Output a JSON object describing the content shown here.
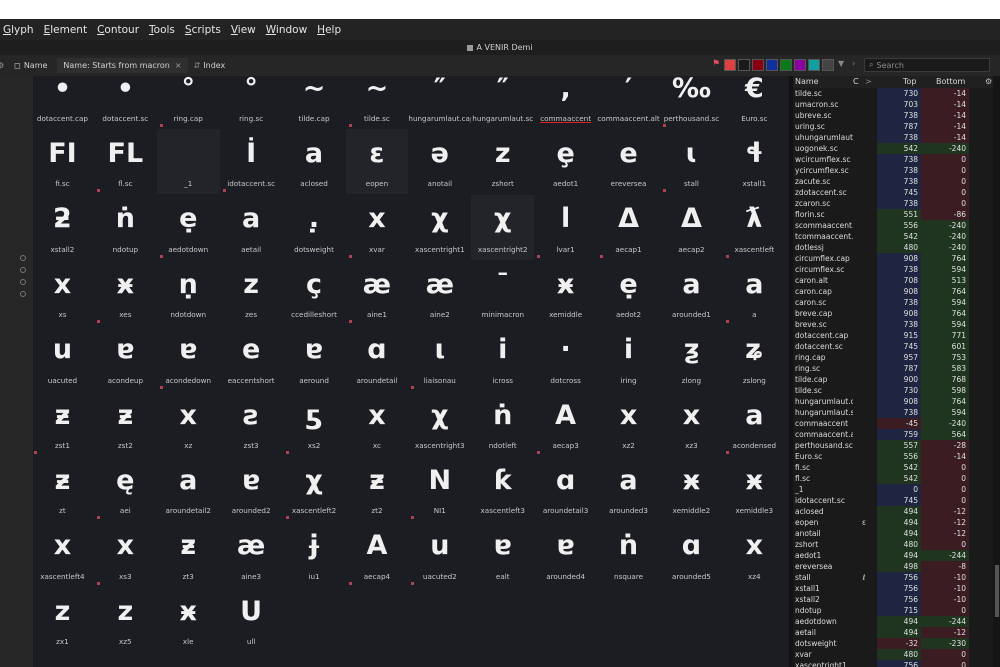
{
  "menu": [
    "Glyph",
    "Element",
    "Contour",
    "Tools",
    "Scripts",
    "View",
    "Window",
    "Help"
  ],
  "window_title": "A VENIR Demi",
  "toolbar": {
    "name_label": "Name",
    "filter_tab": "Name: Starts from macron",
    "index_label": "Index",
    "search_placeholder": "Search",
    "swatches": [
      "#e04040",
      "#1a1a1a",
      "#8a0010",
      "#1030a0",
      "#0a7a1a",
      "#8a00a0",
      "#10a0a0",
      "#444444"
    ]
  },
  "grid": {
    "selected_glyph": "commaaccent",
    "glyphs": [
      {
        "char": "•",
        "name": "dotaccent.cap",
        "shade": false
      },
      {
        "char": "•",
        "name": "dotaccent.sc",
        "shade": false
      },
      {
        "char": "°",
        "name": "ring.cap",
        "shade": false
      },
      {
        "char": "°",
        "name": "ring.sc",
        "shade": false
      },
      {
        "char": "~",
        "name": "tilde.cap",
        "shade": false
      },
      {
        "char": "~",
        "name": "tilde.sc",
        "shade": false
      },
      {
        "char": "″",
        "name": "hungarumlaut.cap",
        "shade": false
      },
      {
        "char": "″",
        "name": "hungarumlaut.sc",
        "shade": false
      },
      {
        "char": ",",
        "name": "commaaccent",
        "shade": false
      },
      {
        "char": "′",
        "name": "commaaccent.alt",
        "shade": false
      },
      {
        "char": "‰",
        "name": "perthousand.sc",
        "shade": false
      },
      {
        "char": "€",
        "name": "Euro.sc",
        "shade": false
      },
      {
        "char": "FI",
        "name": "fi.sc",
        "shade": false
      },
      {
        "char": "FL",
        "name": "fl.sc",
        "shade": false
      },
      {
        "char": "",
        "name": "_1",
        "shade": true
      },
      {
        "char": "İ",
        "name": "idotaccent.sc",
        "shade": false
      },
      {
        "char": "a",
        "name": "aclosed",
        "shade": false
      },
      {
        "char": "ɛ",
        "name": "eopen",
        "shade": true
      },
      {
        "char": "ə",
        "name": "anotail",
        "shade": false
      },
      {
        "char": "z",
        "name": "zshort",
        "shade": false
      },
      {
        "char": "ȩ",
        "name": "aedot1",
        "shade": false
      },
      {
        "char": "e",
        "name": "ereversea",
        "shade": false
      },
      {
        "char": "ɩ",
        "name": "stall",
        "shade": false
      },
      {
        "char": "ɬ",
        "name": "xstall1",
        "shade": false
      },
      {
        "char": "ƻ",
        "name": "xstall2",
        "shade": false
      },
      {
        "char": "ṅ",
        "name": "ndotup",
        "shade": false
      },
      {
        "char": "ẹ",
        "name": "aedotdown",
        "shade": false
      },
      {
        "char": "a",
        "name": "aetail",
        "shade": false
      },
      {
        "char": ".̣",
        "name": "dotsweight",
        "shade": false
      },
      {
        "char": "x",
        "name": "xvar",
        "shade": false
      },
      {
        "char": "χ",
        "name": "xascentright1",
        "shade": false
      },
      {
        "char": "χ",
        "name": "xascentright2",
        "shade": true
      },
      {
        "char": "l",
        "name": "lvar1",
        "shade": false
      },
      {
        "char": "Δ",
        "name": "aecap1",
        "shade": false
      },
      {
        "char": "Δ",
        "name": "aecap2",
        "shade": false
      },
      {
        "char": "ƛ",
        "name": "xascentleft",
        "shade": false
      },
      {
        "char": "x",
        "name": "xs",
        "shade": false
      },
      {
        "char": "ӿ",
        "name": "xes",
        "shade": false
      },
      {
        "char": "ṇ",
        "name": "ndotdown",
        "shade": false
      },
      {
        "char": "z",
        "name": "zes",
        "shade": false
      },
      {
        "char": "ç",
        "name": "ccedilleshort",
        "shade": false
      },
      {
        "char": "æ",
        "name": "aine1",
        "shade": false
      },
      {
        "char": "æ",
        "name": "aine2",
        "shade": false
      },
      {
        "char": "¯",
        "name": "minimacron",
        "shade": false
      },
      {
        "char": "ӿ",
        "name": "xemiddle",
        "shade": false
      },
      {
        "char": "ẹ",
        "name": "aedot2",
        "shade": false
      },
      {
        "char": "a",
        "name": "arounded1",
        "shade": false
      },
      {
        "char": "a",
        "name": "a",
        "shade": false
      },
      {
        "char": "u",
        "name": "uacuted",
        "shade": false
      },
      {
        "char": "ɐ",
        "name": "acondeup",
        "shade": false
      },
      {
        "char": "ɐ",
        "name": "acondedown",
        "shade": false
      },
      {
        "char": "e",
        "name": "eaccentshort",
        "shade": false
      },
      {
        "char": "ɐ",
        "name": "aeround",
        "shade": false
      },
      {
        "char": "ɑ",
        "name": "aroundetail",
        "shade": false
      },
      {
        "char": "ι",
        "name": "liaisonau",
        "shade": false
      },
      {
        "char": "i",
        "name": "icross",
        "shade": false
      },
      {
        "char": "·",
        "name": "dotcross",
        "shade": false
      },
      {
        "char": "i",
        "name": "iring",
        "shade": false
      },
      {
        "char": "ƺ",
        "name": "zlong",
        "shade": false
      },
      {
        "char": "ʑ",
        "name": "zslong",
        "shade": false
      },
      {
        "char": "ƶ",
        "name": "zst1",
        "shade": false
      },
      {
        "char": "ƶ",
        "name": "zst2",
        "shade": false
      },
      {
        "char": "ⅹ",
        "name": "xz",
        "shade": false
      },
      {
        "char": "ƨ",
        "name": "zst3",
        "shade": false
      },
      {
        "char": "ƽ",
        "name": "xs2",
        "shade": false
      },
      {
        "char": "x",
        "name": "xc",
        "shade": false
      },
      {
        "char": "χ",
        "name": "xascentright3",
        "shade": false
      },
      {
        "char": "ṅ",
        "name": "ndotleft",
        "shade": false
      },
      {
        "char": "A",
        "name": "aecap3",
        "shade": false
      },
      {
        "char": "ⅹ",
        "name": "xz2",
        "shade": false
      },
      {
        "char": "ⅹ",
        "name": "xz3",
        "shade": false
      },
      {
        "char": "a",
        "name": "acondensed",
        "shade": false
      },
      {
        "char": "ƶ",
        "name": "zt",
        "shade": false
      },
      {
        "char": "ę",
        "name": "aei",
        "shade": false
      },
      {
        "char": "a",
        "name": "aroundetail2",
        "shade": false
      },
      {
        "char": "ɐ",
        "name": "arounded2",
        "shade": false
      },
      {
        "char": "χ",
        "name": "xascentleft2",
        "shade": false
      },
      {
        "char": "ƶ",
        "name": "zt2",
        "shade": false
      },
      {
        "char": "N",
        "name": "NI1",
        "shade": false
      },
      {
        "char": "ƙ",
        "name": "xascentleft3",
        "shade": false
      },
      {
        "char": "ɑ",
        "name": "aroundetail3",
        "shade": false
      },
      {
        "char": "a",
        "name": "arounded3",
        "shade": false
      },
      {
        "char": "ӿ",
        "name": "xemiddle2",
        "shade": false
      },
      {
        "char": "ӿ",
        "name": "xemiddle3",
        "shade": false
      },
      {
        "char": "x",
        "name": "xascentleft4",
        "shade": false
      },
      {
        "char": "x",
        "name": "xs3",
        "shade": false
      },
      {
        "char": "ƶ",
        "name": "zt3",
        "shade": false
      },
      {
        "char": "æ",
        "name": "aine3",
        "shade": false
      },
      {
        "char": "ɉ",
        "name": "iu1",
        "shade": false
      },
      {
        "char": "A",
        "name": "aecap4",
        "shade": false
      },
      {
        "char": "u",
        "name": "uacuted2",
        "shade": false
      },
      {
        "char": "ɐ",
        "name": "ealt",
        "shade": false
      },
      {
        "char": "ɐ",
        "name": "arounded4",
        "shade": false
      },
      {
        "char": "ṅ",
        "name": "nsquare",
        "shade": false
      },
      {
        "char": "ɑ",
        "name": "arounded5",
        "shade": false
      },
      {
        "char": "ⅹ",
        "name": "xz4",
        "shade": false
      },
      {
        "char": "z",
        "name": "zx1",
        "shade": false
      },
      {
        "char": "z",
        "name": "xz5",
        "shade": false
      },
      {
        "char": "ӿ",
        "name": "xle",
        "shade": false
      },
      {
        "char": "U",
        "name": "ull",
        "shade": false
      }
    ]
  },
  "panel": {
    "headers": {
      "name": "Name",
      "c": "C",
      "top": "Top",
      "bottom": "Bottom"
    },
    "rows": [
      {
        "name": "tilde.sc",
        "c": "",
        "top": "730",
        "bottom": "-14"
      },
      {
        "name": "umacron.sc",
        "c": "",
        "top": "703",
        "bottom": "-14"
      },
      {
        "name": "ubreve.sc",
        "c": "",
        "top": "738",
        "bottom": "-14"
      },
      {
        "name": "uring.sc",
        "c": "",
        "top": "787",
        "bottom": "-14"
      },
      {
        "name": "uhungarumlaut.sc",
        "c": "",
        "top": "738",
        "bottom": "-14"
      },
      {
        "name": "uogonek.sc",
        "c": "",
        "top": "542",
        "bottom": "-240"
      },
      {
        "name": "wcircumflex.sc",
        "c": "",
        "top": "738",
        "bottom": "0"
      },
      {
        "name": "ycircumflex.sc",
        "c": "",
        "top": "738",
        "bottom": "0"
      },
      {
        "name": "zacute.sc",
        "c": "",
        "top": "738",
        "bottom": "0"
      },
      {
        "name": "zdotaccent.sc",
        "c": "",
        "top": "745",
        "bottom": "0"
      },
      {
        "name": "zcaron.sc",
        "c": "",
        "top": "738",
        "bottom": "0"
      },
      {
        "name": "florin.sc",
        "c": "",
        "top": "551",
        "bottom": "-86"
      },
      {
        "name": "scommaaccent.sc",
        "c": "",
        "top": "556",
        "bottom": "-240"
      },
      {
        "name": "tcommaaccent.sc",
        "c": "",
        "top": "542",
        "bottom": "-240"
      },
      {
        "name": "dotlessj",
        "c": "",
        "top": "480",
        "bottom": "-240"
      },
      {
        "name": "circumflex.cap",
        "c": "",
        "top": "908",
        "bottom": "764"
      },
      {
        "name": "circumflex.sc",
        "c": "",
        "top": "738",
        "bottom": "594"
      },
      {
        "name": "caron.alt",
        "c": "",
        "top": "708",
        "bottom": "513"
      },
      {
        "name": "caron.cap",
        "c": "",
        "top": "908",
        "bottom": "764"
      },
      {
        "name": "caron.sc",
        "c": "",
        "top": "738",
        "bottom": "594"
      },
      {
        "name": "breve.cap",
        "c": "",
        "top": "908",
        "bottom": "764"
      },
      {
        "name": "breve.sc",
        "c": "",
        "top": "738",
        "bottom": "594"
      },
      {
        "name": "dotaccent.cap",
        "c": "",
        "top": "915",
        "bottom": "771"
      },
      {
        "name": "dotaccent.sc",
        "c": "",
        "top": "745",
        "bottom": "601"
      },
      {
        "name": "ring.cap",
        "c": "",
        "top": "957",
        "bottom": "753"
      },
      {
        "name": "ring.sc",
        "c": "",
        "top": "787",
        "bottom": "583"
      },
      {
        "name": "tilde.cap",
        "c": "",
        "top": "900",
        "bottom": "768"
      },
      {
        "name": "tilde.sc",
        "c": "",
        "top": "730",
        "bottom": "598"
      },
      {
        "name": "hungarumlaut.cap",
        "c": "",
        "top": "908",
        "bottom": "764"
      },
      {
        "name": "hungarumlaut.sc",
        "c": "",
        "top": "738",
        "bottom": "594"
      },
      {
        "name": "commaaccent",
        "c": "",
        "top": "-45",
        "bottom": "-240"
      },
      {
        "name": "commaaccent.alt",
        "c": "",
        "top": "759",
        "bottom": "564"
      },
      {
        "name": "perthousand.sc",
        "c": "",
        "top": "557",
        "bottom": "-28"
      },
      {
        "name": "Euro.sc",
        "c": "",
        "top": "556",
        "bottom": "-14"
      },
      {
        "name": "fi.sc",
        "c": "",
        "top": "542",
        "bottom": "0"
      },
      {
        "name": "fl.sc",
        "c": "",
        "top": "542",
        "bottom": "0"
      },
      {
        "name": "_1",
        "c": "",
        "top": "0",
        "bottom": "0"
      },
      {
        "name": "idotaccent.sc",
        "c": "",
        "top": "745",
        "bottom": "0"
      },
      {
        "name": "aclosed",
        "c": "",
        "top": "494",
        "bottom": "-12"
      },
      {
        "name": "eopen",
        "c": "ε",
        "top": "494",
        "bottom": "-12"
      },
      {
        "name": "anotail",
        "c": "",
        "top": "494",
        "bottom": "-12"
      },
      {
        "name": "zshort",
        "c": "",
        "top": "480",
        "bottom": "0"
      },
      {
        "name": "aedot1",
        "c": "",
        "top": "494",
        "bottom": "-244"
      },
      {
        "name": "ereversea",
        "c": "",
        "top": "498",
        "bottom": "-8"
      },
      {
        "name": "stall",
        "c": "ℓ",
        "top": "756",
        "bottom": "-10"
      },
      {
        "name": "xstall1",
        "c": "",
        "top": "756",
        "bottom": "-10"
      },
      {
        "name": "xstall2",
        "c": "",
        "top": "756",
        "bottom": "-10"
      },
      {
        "name": "ndotup",
        "c": "",
        "top": "715",
        "bottom": "0"
      },
      {
        "name": "aedotdown",
        "c": "",
        "top": "494",
        "bottom": "-244"
      },
      {
        "name": "aetail",
        "c": "",
        "top": "494",
        "bottom": "-12"
      },
      {
        "name": "dotsweight",
        "c": "",
        "top": "-32",
        "bottom": "-230"
      },
      {
        "name": "xvar",
        "c": "",
        "top": "480",
        "bottom": "0"
      },
      {
        "name": "xascentright1",
        "c": "",
        "top": "756",
        "bottom": "0"
      }
    ]
  },
  "colors": {
    "panel_blue": "#1f2440",
    "panel_green": "#1f3520",
    "panel_red": "#3a1c22",
    "mark": "#b04050"
  }
}
